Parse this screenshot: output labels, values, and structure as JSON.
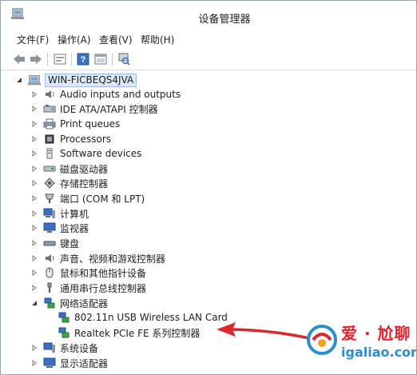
{
  "window": {
    "title": "设备管理器"
  },
  "menu": [
    {
      "label": "文件(F)"
    },
    {
      "label": "操作(A)"
    },
    {
      "label": "查看(V)"
    },
    {
      "label": "帮助(H)"
    }
  ],
  "toolbar": {
    "icons": [
      "back-arrow-icon",
      "forward-arrow-icon",
      "properties-icon",
      "help-icon",
      "view-icon",
      "scan-hardware-icon"
    ]
  },
  "tree": {
    "root": {
      "label": "WIN-FICBEQS4JVA",
      "icon": "computer-icon"
    },
    "items": [
      {
        "label": "Audio inputs and outputs",
        "icon": "speaker-icon",
        "expanded": false
      },
      {
        "label": "IDE ATA/ATAPI 控制器",
        "icon": "disk-controller-icon",
        "expanded": false
      },
      {
        "label": "Print queues",
        "icon": "printer-icon",
        "expanded": false
      },
      {
        "label": "Processors",
        "icon": "chip-icon",
        "expanded": false
      },
      {
        "label": "Software devices",
        "icon": "software-device-icon",
        "expanded": false
      },
      {
        "label": "磁盘驱动器",
        "icon": "disk-drive-icon",
        "expanded": false
      },
      {
        "label": "存储控制器",
        "icon": "storage-controller-icon",
        "expanded": false
      },
      {
        "label": "端口 (COM 和 LPT)",
        "icon": "port-icon",
        "expanded": false
      },
      {
        "label": "计算机",
        "icon": "computer-icon",
        "expanded": false
      },
      {
        "label": "监视器",
        "icon": "monitor-icon",
        "expanded": false
      },
      {
        "label": "键盘",
        "icon": "keyboard-icon",
        "expanded": false
      },
      {
        "label": "声音、视频和游戏控制器",
        "icon": "sound-icon",
        "expanded": false
      },
      {
        "label": "鼠标和其他指针设备",
        "icon": "mouse-icon",
        "expanded": false
      },
      {
        "label": "通用串行总线控制器",
        "icon": "usb-icon",
        "expanded": false
      },
      {
        "label": "网络适配器",
        "icon": "network-icon",
        "expanded": true,
        "children": [
          {
            "label": "802.11n USB Wireless LAN Card",
            "icon": "network-adapter-icon"
          },
          {
            "label": "Realtek PCIe FE 系列控制器",
            "icon": "network-adapter-icon"
          }
        ]
      },
      {
        "label": "系统设备",
        "icon": "system-device-icon",
        "expanded": false
      },
      {
        "label": "显示适配器",
        "icon": "display-adapter-icon",
        "expanded": false
      }
    ]
  },
  "annotation": {
    "arrow_color": "#e0262d"
  },
  "watermark": {
    "title": "爱 · 尬聊",
    "url": "igaliao.com"
  }
}
